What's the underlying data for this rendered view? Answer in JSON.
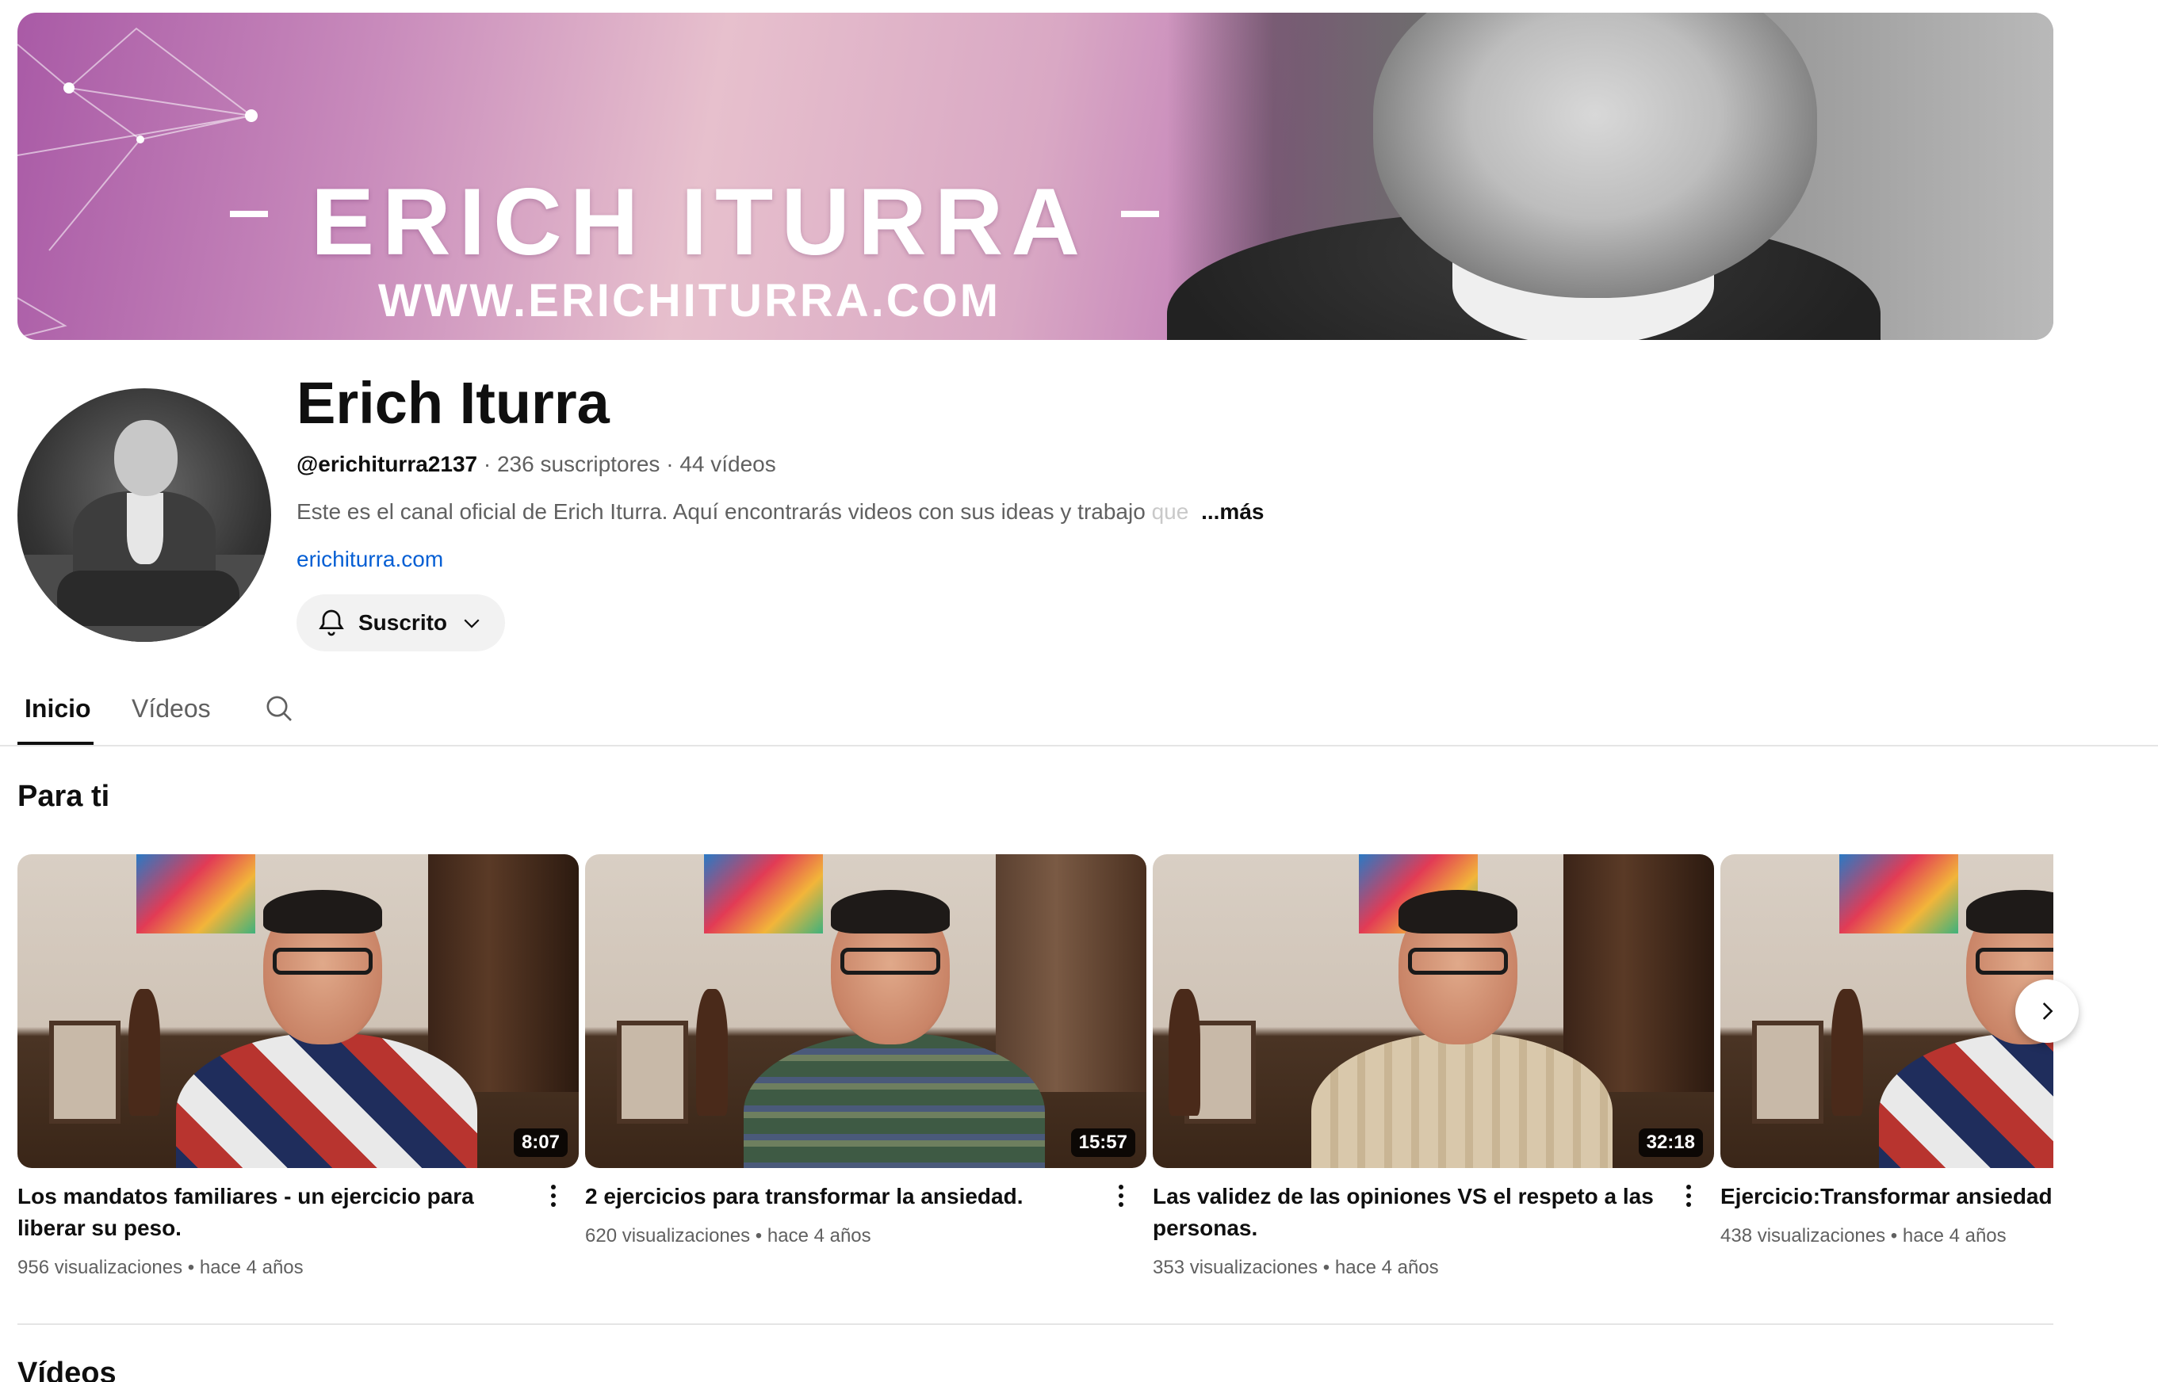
{
  "banner": {
    "title": "ERICH ITURRA",
    "url": "WWW.ERICHITURRA.COM"
  },
  "channel": {
    "name": "Erich Iturra",
    "handle": "@erichiturra2137",
    "subscribers": "236 suscriptores",
    "videos_count": "44 vídeos",
    "separator": "·",
    "description": "Este es el canal oficial de Erich Iturra. Aquí encontrarás videos con sus ideas y trabajo",
    "description_fade": "que",
    "more_label": "...más",
    "link": "erichiturra.com",
    "subscribe_label": "Suscrito"
  },
  "tabs": [
    {
      "label": "Inicio",
      "active": true
    },
    {
      "label": "Vídeos",
      "active": false
    }
  ],
  "section_for_you": {
    "title": "Para ti",
    "videos": [
      {
        "title": "Los mandatos familiares - un ejercicio para liberar su peso.",
        "views": "956 visualizaciones",
        "age": "hace 4 años",
        "duration": "8:07",
        "sweater": "argyle"
      },
      {
        "title": "2 ejercicios para transformar la ansiedad.",
        "views": "620 visualizaciones",
        "age": "hace 4 años",
        "duration": "15:57",
        "sweater": "green"
      },
      {
        "title": "Las validez de las opiniones VS el respeto a las personas.",
        "views": "353 visualizaciones",
        "age": "hace 4 años",
        "duration": "32:18",
        "sweater": "cream"
      },
      {
        "title": "Ejercicio:Transformar ansiedad de",
        "views": "438 visualizaciones",
        "age": "hace 4 años",
        "duration": "",
        "sweater": "argyle"
      }
    ],
    "meta_dot": "•"
  },
  "section_videos": {
    "title": "Vídeos"
  },
  "colors": {
    "link": "#065fd4",
    "muted": "#606060",
    "text": "#0f0f0f"
  }
}
